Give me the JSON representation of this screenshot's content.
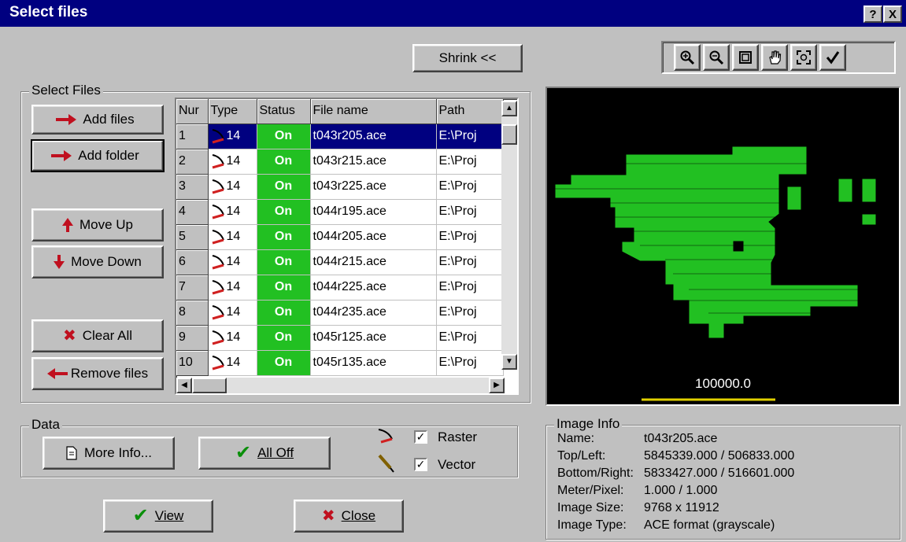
{
  "window": {
    "title": "Select files",
    "help_label": "?",
    "close_label": "X"
  },
  "shrink_label": "Shrink <<",
  "select_files": {
    "group_label": "Select Files",
    "add_files": "Add files",
    "add_folder": "Add folder",
    "move_up": "Move Up",
    "move_down": "Move Down",
    "clear_all": "Clear All",
    "remove_files": "Remove files"
  },
  "file_list": {
    "headers": [
      "Nur",
      "Type",
      "Status",
      "File name",
      "Path"
    ],
    "rows": [
      {
        "num": "1",
        "type": "14",
        "status": "On",
        "file": "t043r205.ace",
        "path": "E:\\Proj"
      },
      {
        "num": "2",
        "type": "14",
        "status": "On",
        "file": "t043r215.ace",
        "path": "E:\\Proj"
      },
      {
        "num": "3",
        "type": "14",
        "status": "On",
        "file": "t043r225.ace",
        "path": "E:\\Proj"
      },
      {
        "num": "4",
        "type": "14",
        "status": "On",
        "file": "t044r195.ace",
        "path": "E:\\Proj"
      },
      {
        "num": "5",
        "type": "14",
        "status": "On",
        "file": "t044r205.ace",
        "path": "E:\\Proj"
      },
      {
        "num": "6",
        "type": "14",
        "status": "On",
        "file": "t044r215.ace",
        "path": "E:\\Proj"
      },
      {
        "num": "7",
        "type": "14",
        "status": "On",
        "file": "t044r225.ace",
        "path": "E:\\Proj"
      },
      {
        "num": "8",
        "type": "14",
        "status": "On",
        "file": "t044r235.ace",
        "path": "E:\\Proj"
      },
      {
        "num": "9",
        "type": "14",
        "status": "On",
        "file": "t045r125.ace",
        "path": "E:\\Proj"
      },
      {
        "num": "10",
        "type": "14",
        "status": "On",
        "file": "t045r135.ace",
        "path": "E:\\Proj"
      }
    ],
    "selected_row": 1
  },
  "toolbar": {
    "icons": [
      "zoom-in-icon",
      "zoom-out-icon",
      "fit-window-icon",
      "pan-hand-icon",
      "zoom-extent-icon",
      "check-icon"
    ]
  },
  "preview": {
    "scale_label": "100000.0",
    "accent_color": "#22c022"
  },
  "data_group": {
    "group_label": "Data",
    "more_info": "More Info...",
    "all_off": "All Off",
    "raster_label": "Raster",
    "vector_label": "Vector",
    "raster_checked": true,
    "vector_checked": true
  },
  "image_info": {
    "group_label": "Image Info",
    "rows": [
      {
        "key": "Name:",
        "value": "t043r205.ace"
      },
      {
        "key": "Top/Left:",
        "value": "5845339.000 / 506833.000"
      },
      {
        "key": "Bottom/Right:",
        "value": "5833427.000 / 516601.000"
      },
      {
        "key": "Meter/Pixel:",
        "value": "1.000 / 1.000"
      },
      {
        "key": "Image Size:",
        "value": "9768 x 11912"
      },
      {
        "key": "Image Type:",
        "value": "ACE format (grayscale)"
      }
    ]
  },
  "footer": {
    "view_label": "View",
    "close_label": "Close"
  }
}
